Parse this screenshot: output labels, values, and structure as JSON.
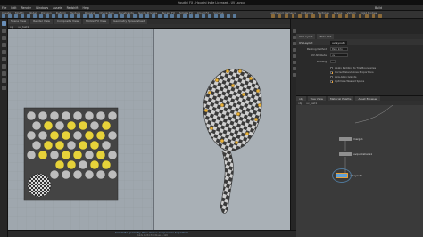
{
  "window": {
    "title": "Houdini FX - Houdini Indie Licensed - UV Layout"
  },
  "menu": [
    "File",
    "Edit",
    "Render",
    "Windows",
    "Assets",
    "Redshift",
    "Help"
  ],
  "shelf_tabs": [
    "Create",
    "Modify",
    "Model",
    "Polygon",
    "Deform",
    "Texture",
    "Rigging",
    "Characters",
    "Constraints",
    "Guide Process",
    "Terrain FX",
    "Simple FX",
    "Cloud FX",
    "Volume"
  ],
  "shelf2_tabs": [
    "Lights and Cameras",
    "Collisions",
    "Particles",
    "Grains",
    "Vellum",
    "Rigid Bodies"
  ],
  "workspace_label": "Build",
  "viewport": {
    "tabs": [
      "Scene View",
      "Render View",
      "Composite View",
      "Motion FX View",
      "Geometry Spreadsheet"
    ],
    "toolbar": [
      "obj",
      "uv_test1"
    ],
    "status_message": "Select the geometry, then choose an operation to perform.",
    "info": "Indie Non-Commercial Edition",
    "counts": "Points 1,234  Primitives 1,126"
  },
  "params": {
    "tabs": [
      "UV Layout",
      "Take List"
    ],
    "header": {
      "node": "uvlayout1",
      "name": "UV Layout"
    },
    "rows": [
      {
        "label": "Packing Method",
        "value": "Pack Into"
      },
      {
        "label": "UV Attribute",
        "value": "uv"
      },
      {
        "label": "Padding",
        "value": ""
      }
    ],
    "checks": [
      {
        "label": "Apply Padding to Tile Boundaries",
        "on": false
      },
      {
        "label": "Correct Island Area Proportions",
        "on": true
      },
      {
        "label": "Axis-Align Islands",
        "on": false
      },
      {
        "label": "Optimize Wasted Space",
        "on": true
      }
    ]
  },
  "network": {
    "tabs": [
      "obj",
      "Tree View",
      "Material Palette",
      "Asset Browser"
    ],
    "path": [
      "obj",
      "uv_test1"
    ],
    "nodes": [
      {
        "name": "merge1",
        "color": "#8f8f8f"
      },
      {
        "name": "uvquickshade1",
        "color": "#8f8f8f"
      },
      {
        "name": "uvlayout1",
        "color": "#5ea0d8"
      }
    ]
  }
}
